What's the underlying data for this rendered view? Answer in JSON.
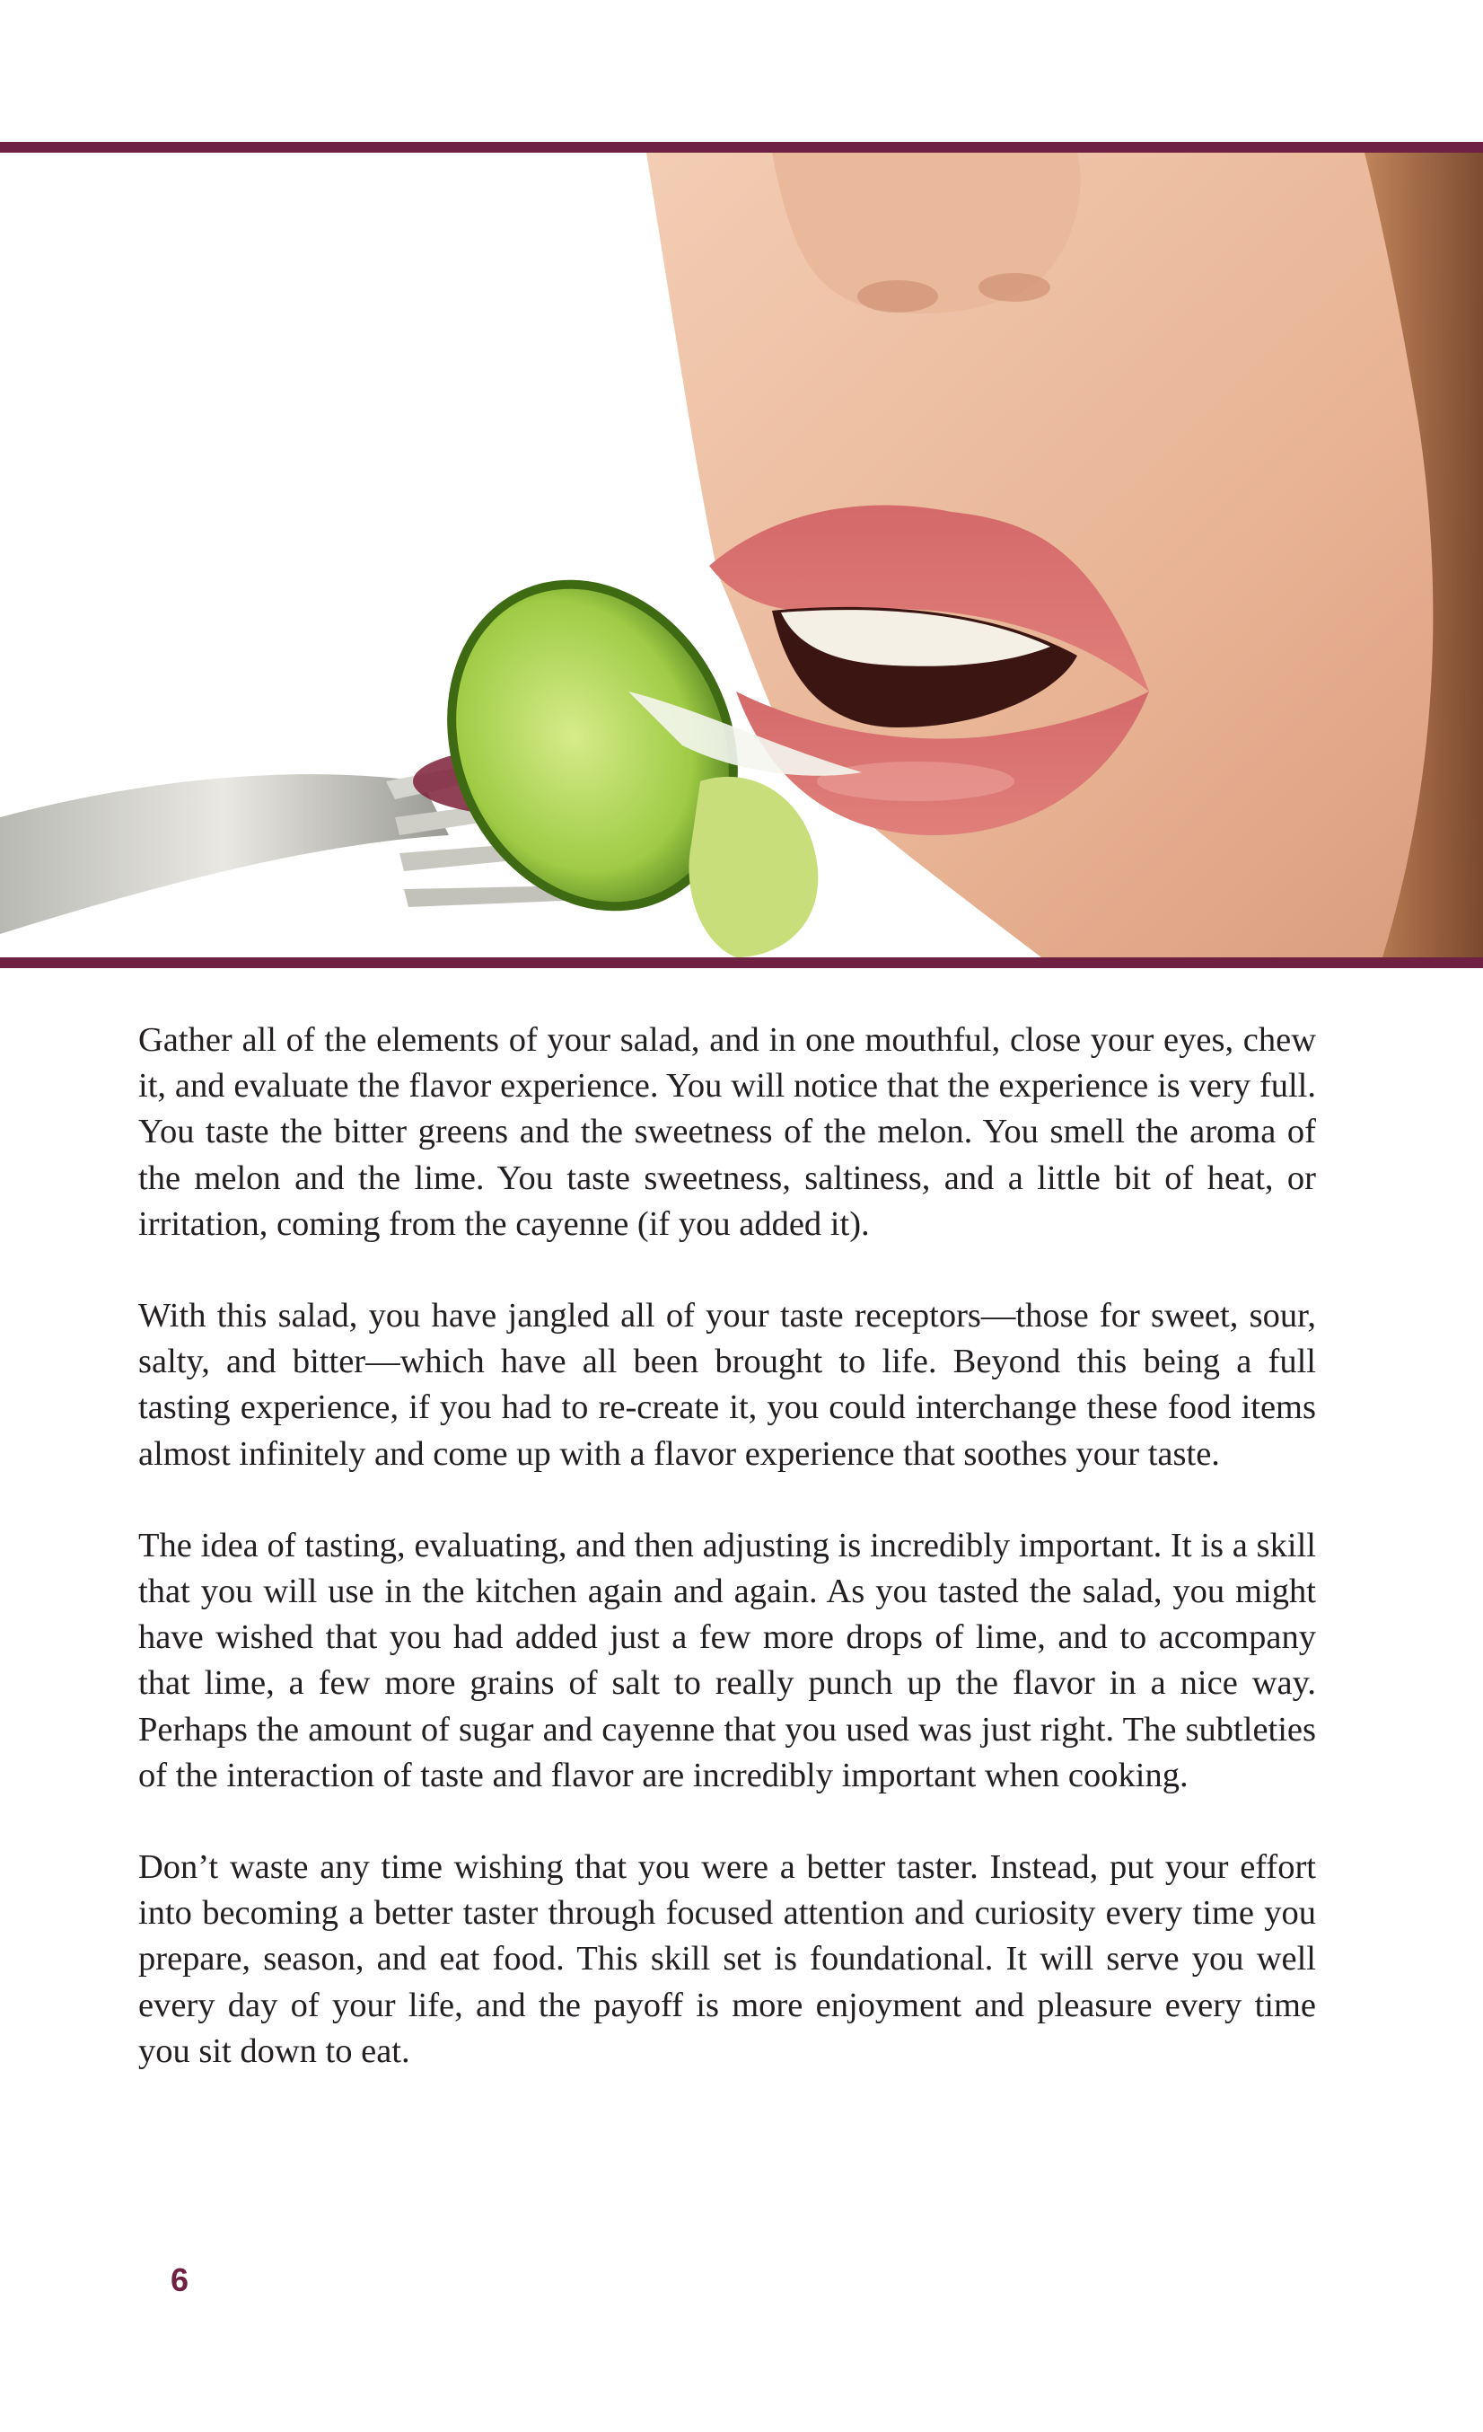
{
  "article": {
    "paragraphs": [
      "Gather all of the elements of your salad, and in one mouthful, close your eyes, chew it, and evaluate the flavor experience. You will notice that the experience is very full. You taste the bitter greens and the sweetness of the melon. You smell the aroma of the melon and the lime. You taste sweetness, saltiness, and a little bit of heat, or irritation, coming from the cayenne (if you added it).",
      "With this salad, you have jangled all of your taste receptors—those for sweet, sour, salty, and bitter—which have all been brought to life. Beyond this being a full tasting experience, if you had to re-create it, you could interchange these food items almost infinitely and come up with a flavor experience that soothes your taste.",
      "The idea of tasting, evaluating, and then adjusting is incredibly important. It is a skill that you will use in the kitchen again and again. As you tasted the salad, you might have wished that you had added just a few more drops of lime, and to accompany that lime, a few more grains of salt to really punch up the flavor in a nice way. Perhaps the amount of sugar and cayenne that you used was just right. The subtleties of the interaction of taste and flavor are incredibly important when cooking.",
      "Don’t waste any time wishing that you were a better taster. Instead, put your effort into becoming a better taster through focused attention and curiosity every time you prepare, season, and eat food. This skill set is foundational. It will serve you well every day of your life, and the payoff is more enjoyment and pleasure every time you sit down to eat."
    ]
  },
  "footer": {
    "page_number": "6"
  },
  "colors": {
    "accent_rule": "#6e2142",
    "body_text": "#231f20"
  }
}
